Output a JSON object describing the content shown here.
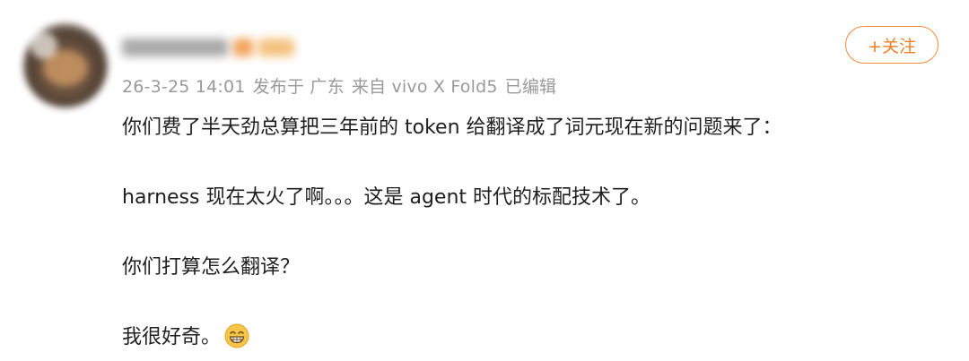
{
  "post": {
    "meta": {
      "date": "26-3-25 14:01",
      "location": "发布于 广东",
      "device": "来自 vivo X Fold5",
      "edited": "已编辑"
    },
    "follow_button": {
      "icon": "plus-icon",
      "label": "+关注"
    },
    "content": {
      "lines": [
        "你们费了半天劲总算把三年前的 token 给翻译成了词元现在新的问题来了：",
        "harness 现在太火了啊。。。这是 agent 时代的标配技术了。",
        "你们打算怎么翻译？",
        "我很好奇。"
      ],
      "trailing_emoji": "grinning-face-icon"
    }
  },
  "colors": {
    "accent": "#f07d28",
    "meta_text": "#999999",
    "body_text": "#1f1f1f"
  }
}
